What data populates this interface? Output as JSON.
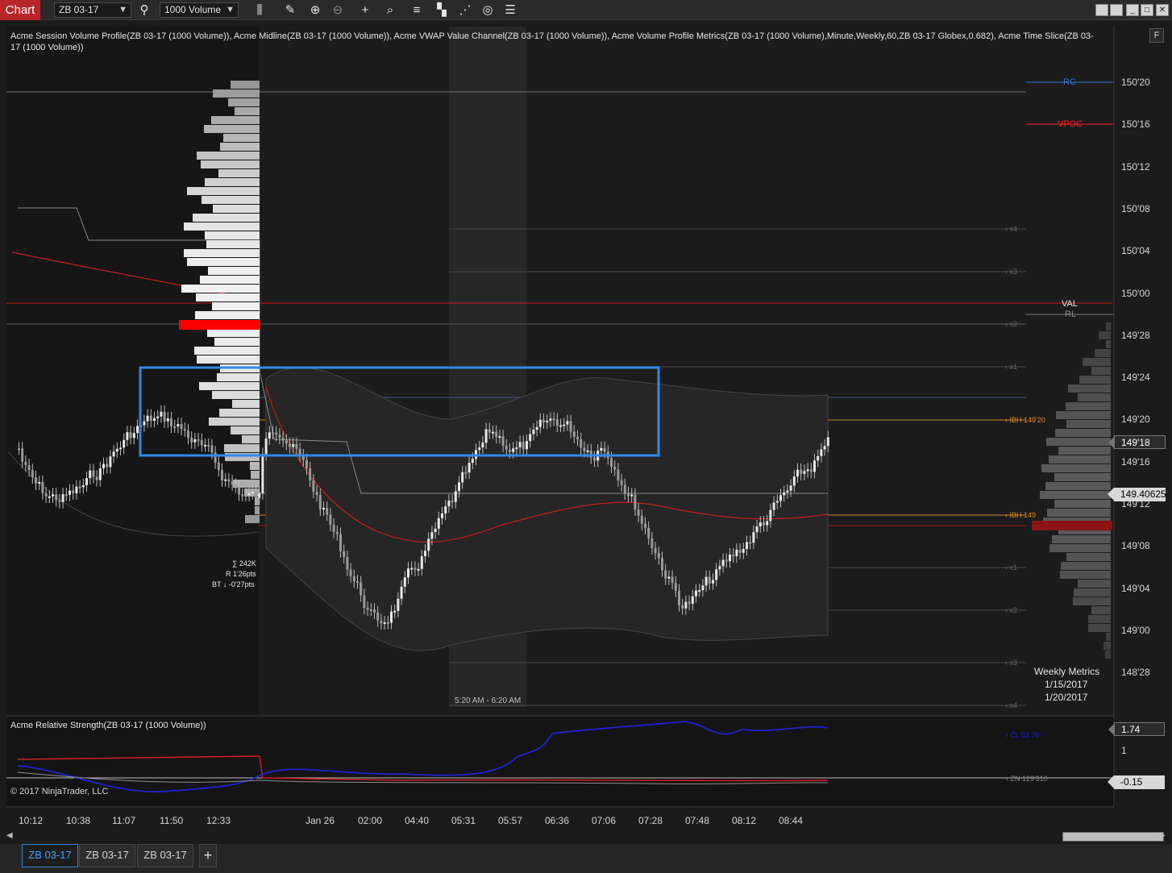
{
  "toolbar": {
    "chart_tab": "Chart",
    "instrument": "ZB 03-17",
    "bar_type": "1000 Volume"
  },
  "main_title": "Acme Session Volume Profile(ZB 03-17 (1000 Volume)), Acme Midline(ZB 03-17 (1000 Volume)), Acme VWAP Value Channel(ZB 03-17 (1000 Volume)), Acme Volume Profile Metrics(ZB 03-17 (1000 Volume),Minute,Weekly,60,ZB 03-17 Globex,0.682), Acme Time Slice(ZB 03-17 (1000 Volume))",
  "price_axis": [
    "150'20",
    "150'16",
    "150'12",
    "150'08",
    "150'04",
    "150'00",
    "149'28",
    "149'24",
    "149'20",
    "149'16",
    "149'12",
    "149'08",
    "149'04",
    "149'00",
    "148'28"
  ],
  "price_markers": {
    "last_price": "149'18",
    "cursor_price": "149.40625"
  },
  "levels": {
    "rc": "RC",
    "vpoc": "VPOC",
    "val": "VAL",
    "rl": "RL",
    "ibh": "IBH",
    "ibh_value": "149'20",
    "ibh2": "IBH"
  },
  "level_labels": [
    "x4",
    "x3",
    "x2",
    "x1",
    "x1",
    "x2",
    "x3",
    "x4"
  ],
  "session_stats": {
    "volume": "∑ 242K",
    "range": "R 1'26pts",
    "bt": "BT ↓ -0'27pts"
  },
  "time_slice": "5:20 AM - 6:20 AM",
  "weekly_metrics": {
    "title": "Weekly Metrics",
    "start": "1/15/2017",
    "end": "1/20/2017"
  },
  "rs_panel": {
    "title": "Acme Relative Strength(ZB 03-17 (1000 Volume))",
    "value_top": "1.74",
    "axis_one": "1",
    "value_bottom": "-0.15",
    "cl_label": "CL 53.76",
    "zn_label": "ZN 129'310"
  },
  "copyright": "© 2017 NinjaTrader, LLC",
  "time_axis": [
    "10:12",
    "10:38",
    "11:07",
    "11:50",
    "12:33",
    "Jan 26",
    "02:00",
    "04:40",
    "05:31",
    "05:57",
    "06:36",
    "07:06",
    "07:28",
    "07:48",
    "08:12",
    "08:44"
  ],
  "bottom_tabs": [
    "ZB 03-17",
    "ZB 03-17",
    "ZB 03-17"
  ],
  "colors": {
    "accent_red": "#b8262a",
    "selection_blue": "#2f8be6",
    "vpoc_red": "#ff0000",
    "rc_blue": "#3a6fd8",
    "ibh_orange": "#e08a2a"
  }
}
